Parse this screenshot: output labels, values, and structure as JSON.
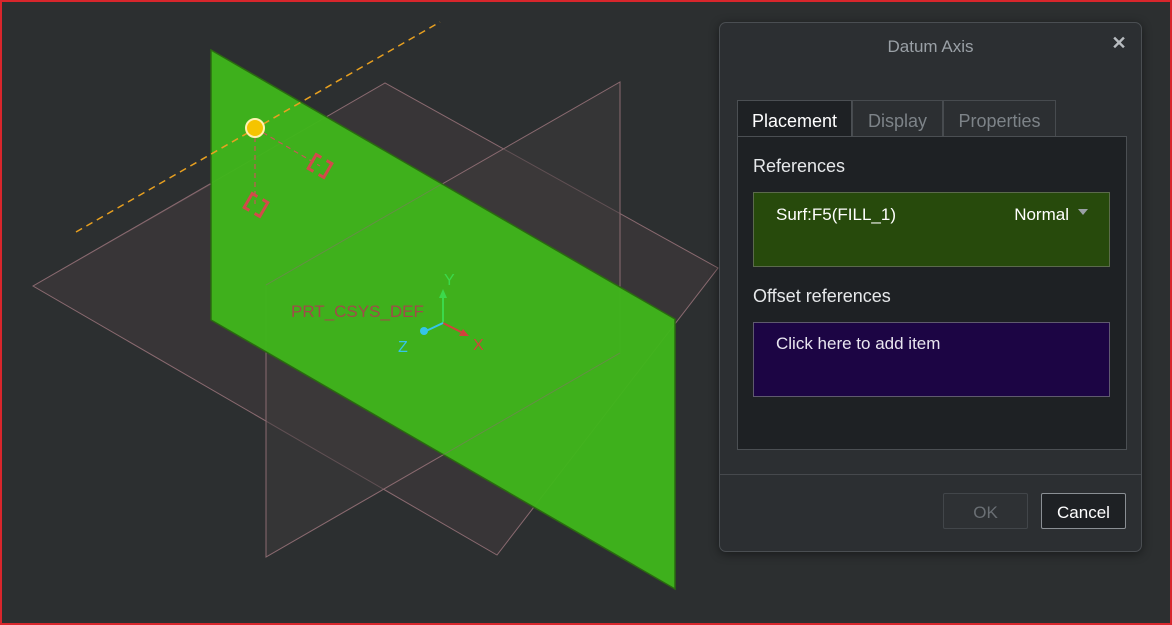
{
  "viewport": {
    "csys_label": "PRT_CSYS_DEF",
    "axes": {
      "x": "X",
      "y": "Y",
      "z": "Z"
    },
    "colors": {
      "background": "#2c2f30",
      "surface_fill": "#40b51b",
      "datum_plane_edge": "#8a6a70",
      "axis_line": "#e8a020",
      "reference_point": "#f5c400",
      "constraint_handle": "#d24a4a"
    }
  },
  "dialog": {
    "title": "Datum Axis",
    "close_icon": "close-icon",
    "tabs": [
      {
        "label": "Placement",
        "active": true
      },
      {
        "label": "Display",
        "active": false
      },
      {
        "label": "Properties",
        "active": false
      }
    ],
    "references_label": "References",
    "reference_item": "Surf:F5(FILL_1)",
    "reference_type": "Normal",
    "offset_references_label": "Offset references",
    "offset_placeholder": "Click here to add item",
    "ok_label": "OK",
    "cancel_label": "Cancel",
    "colors": {
      "references_box": "#274a0c",
      "offset_box": "#1c0544"
    }
  }
}
